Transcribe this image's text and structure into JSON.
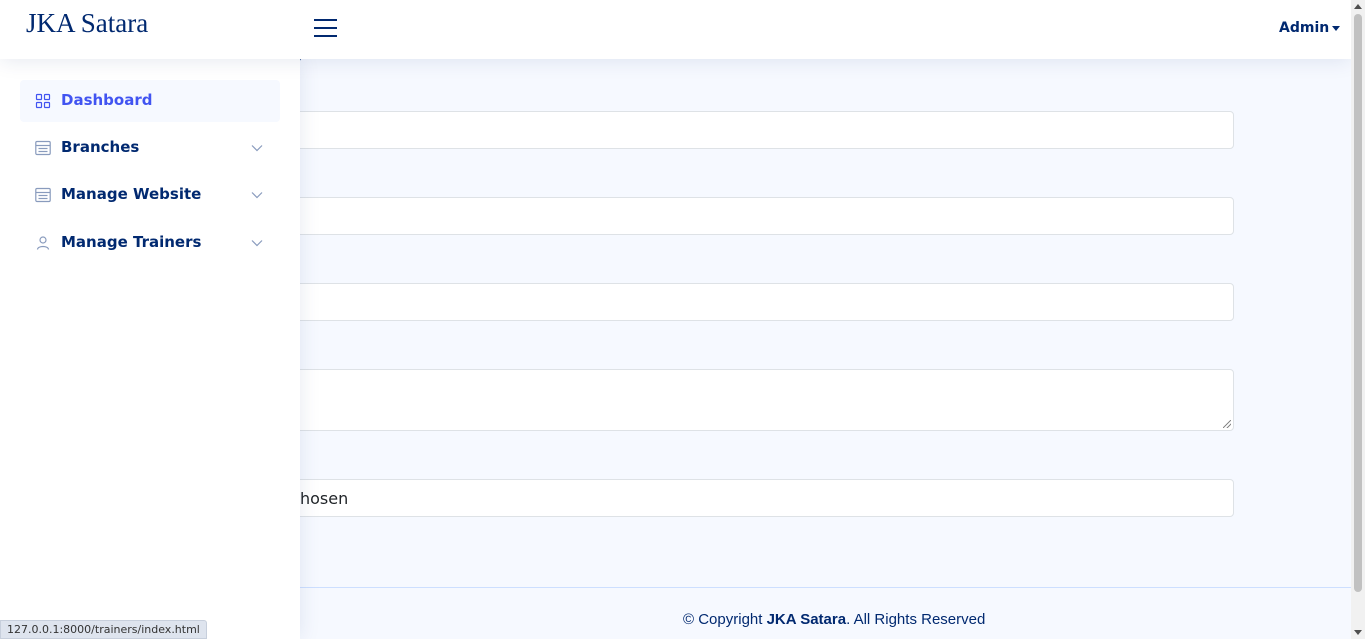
{
  "header": {
    "brand": "JKA Satara",
    "user_menu": "Admin",
    "toggle_icon": "hamburger-icon"
  },
  "main": {
    "heading_fragment": ")",
    "file_input_text": "hosen"
  },
  "sidebar": {
    "items": [
      {
        "label": "Dashboard",
        "icon": "grid-icon",
        "active": true
      },
      {
        "label": "Branches",
        "icon": "layout-text-icon",
        "expandable": true
      },
      {
        "label": "Manage Website",
        "icon": "layout-text-icon",
        "expandable": true
      },
      {
        "label": "Manage Trainers",
        "icon": "person-icon",
        "expandable": true
      }
    ]
  },
  "footer": {
    "copyright_prefix": "© Copyright ",
    "copyright_brand": "JKA Satara",
    "copyright_suffix": ". All Rights Reserved"
  },
  "status_bar": {
    "url": "127.0.0.1:8000/trainers/index.html"
  },
  "colors": {
    "primary": "#012970",
    "accent": "#4154f1",
    "background": "#f6f9ff"
  }
}
